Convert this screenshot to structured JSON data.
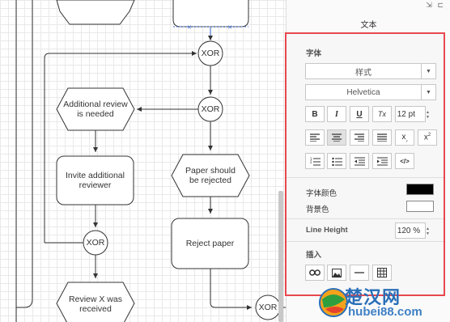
{
  "panel": {
    "tab_title": "文本",
    "window_controls": "⇲ ⊏",
    "font_section": {
      "title": "字体",
      "style_dropdown": "样式",
      "font_dropdown": "Helvetica",
      "buttons": {
        "bold": "B",
        "italic": "I",
        "underline": "U",
        "clear_format": "Tx"
      },
      "font_size": "12 pt",
      "subscript": "x",
      "superscript": "x",
      "html_toggle": "</>"
    },
    "colors": {
      "font_color_label": "字体颜色",
      "font_color_value": "#000000",
      "background_label": "背景色",
      "background_value": "#ffffff"
    },
    "line_height": {
      "label": "Line Height",
      "value": "120 %"
    },
    "insert": {
      "title": "插入"
    }
  },
  "diagram": {
    "nodes": {
      "xor_top": "XOR",
      "xor_mid": "XOR",
      "xor_left": "XOR",
      "xor_bottom": "XOR",
      "additional_review": "Additional review\nis needed",
      "invite_reviewer": "Invite additional\nreviewer",
      "paper_rejected": "Paper should\nbe rejected",
      "reject_paper": "Reject paper",
      "review_received": "Review X was\nreceived"
    }
  },
  "watermark": {
    "brand": "楚汉网",
    "url": "hubei88.com"
  },
  "colors": {
    "highlight_border": "#e8484f",
    "edge": "#333333",
    "selection_handle": "#3d6bd6"
  }
}
